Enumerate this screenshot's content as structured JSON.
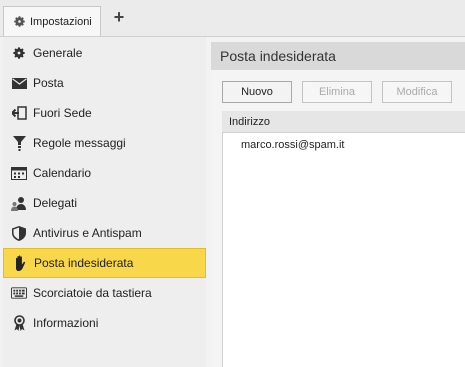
{
  "tabs": [
    {
      "label": "Impostazioni",
      "icon": "gear-icon"
    }
  ],
  "add_tab_label": "+",
  "sidebar": {
    "items": [
      {
        "label": "Generale",
        "icon": "gear-icon"
      },
      {
        "label": "Posta",
        "icon": "envelope-icon"
      },
      {
        "label": "Fuori Sede",
        "icon": "out-of-office-icon"
      },
      {
        "label": "Regole messaggi",
        "icon": "filter-icon"
      },
      {
        "label": "Calendario",
        "icon": "calendar-icon"
      },
      {
        "label": "Delegati",
        "icon": "delegates-icon"
      },
      {
        "label": "Antivirus e Antispam",
        "icon": "shield-icon"
      },
      {
        "label": "Posta indesiderata",
        "icon": "hand-icon",
        "active": true
      },
      {
        "label": "Scorciatoie da tastiera",
        "icon": "keyboard-icon"
      },
      {
        "label": "Informazioni",
        "icon": "info-ribbon-icon"
      }
    ],
    "active_color": "#f8d84a"
  },
  "panel": {
    "title": "Posta indesiderata",
    "buttons": {
      "new_label": "Nuovo",
      "delete_label": "Elimina",
      "edit_label": "Modifica"
    },
    "list": {
      "column_header": "Indirizzo",
      "rows": [
        "marco.rossi@spam.it"
      ]
    }
  }
}
